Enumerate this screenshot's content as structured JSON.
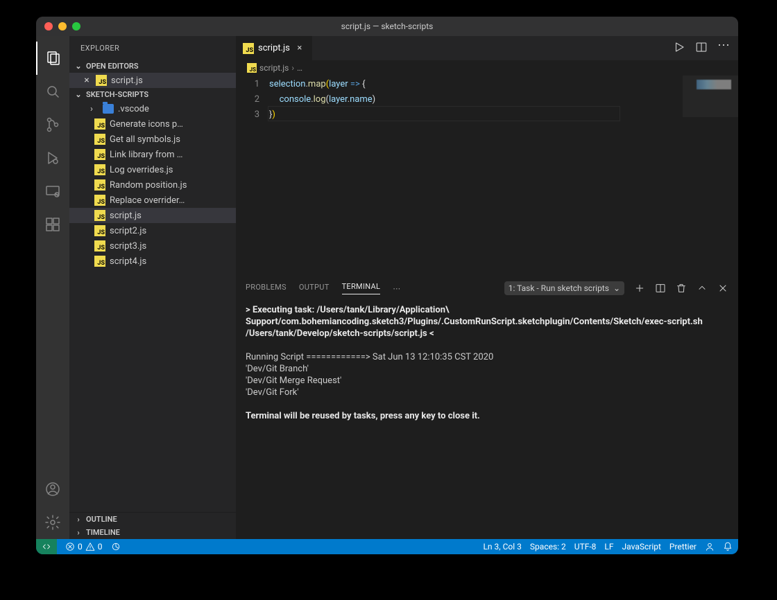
{
  "window": {
    "title": "script.js — sketch-scripts"
  },
  "sidebar": {
    "title": "EXPLORER",
    "open_editors_label": "OPEN EDITORS",
    "open_editors": [
      {
        "name": "script.js"
      }
    ],
    "workspace_label": "SKETCH-SCRIPTS",
    "folder": {
      "name": ".vscode"
    },
    "files": [
      "Generate icons p…",
      "Get all symbols.js",
      "Link library from …",
      "Log overrides.js",
      "Random position.js",
      "Replace overrider…",
      "script.js",
      "script2.js",
      "script3.js",
      "script4.js"
    ],
    "outline_label": "OUTLINE",
    "timeline_label": "TIMELINE"
  },
  "tab": {
    "name": "script.js"
  },
  "breadcrumb": {
    "file": "script.js",
    "more": "…"
  },
  "code": {
    "line_numbers": [
      "1",
      "2",
      "3"
    ],
    "l1": {
      "a": "selection",
      "b": ".",
      "c": "map",
      "d": "(",
      "e": "layer",
      "f": " => ",
      "g": "{"
    },
    "l2": {
      "a": "console",
      "b": ".",
      "c": "log",
      "d": "(",
      "e": "layer",
      "f": ".",
      "g": "name",
      "h": ")"
    },
    "l3": {
      "a": "}",
      "b": ")"
    }
  },
  "panel": {
    "tabs": {
      "problems": "PROBLEMS",
      "output": "OUTPUT",
      "terminal": "TERMINAL"
    },
    "task_selector": "1: Task - Run sketch scripts",
    "body": {
      "exec_line": "> Executing task: /Users/tank/Library/Application\\ Support/com.bohemiancoding.sketch3/Plugins/.CustomRunScript.sketchplugin/Contents/Sketch/exec-script.sh /Users/tank/Develop/sketch-scripts/script.js <",
      "running": "Running Script ============> Sat Jun 13 12:10:35 CST 2020",
      "out1": "'Dev/Git Branch'",
      "out2": "'Dev/Git Merge Request'",
      "out3": "'Dev/Git Fork'",
      "reuse": "Terminal will be reused by tasks, press any key to close it."
    }
  },
  "status": {
    "errors": "0",
    "warnings": "0",
    "pos": "Ln 3, Col 3",
    "indent": "Spaces: 2",
    "encoding": "UTF-8",
    "eol": "LF",
    "lang": "JavaScript",
    "formatter": "Prettier"
  }
}
